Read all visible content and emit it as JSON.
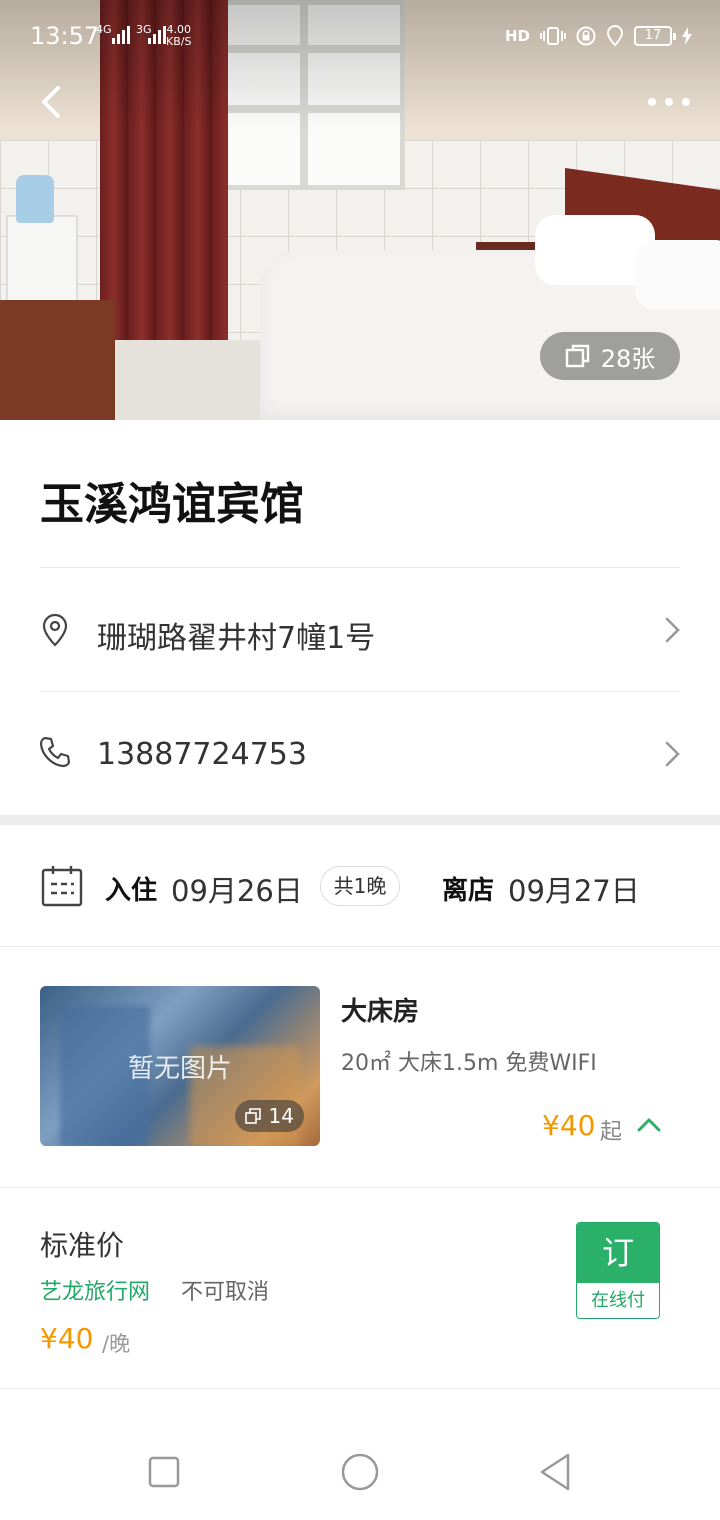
{
  "status_bar": {
    "time": "13:57",
    "net1": "4G",
    "net2": "3G",
    "speed_value": "4.00",
    "speed_unit": "KB/S",
    "hd": "HD",
    "battery": "17"
  },
  "hero": {
    "photo_count": "28张"
  },
  "hotel": {
    "name": "玉溪鸿谊宾馆",
    "address": "珊瑚路翟井村7幢1号",
    "phone": "13887724753"
  },
  "stay": {
    "checkin_label": "入住",
    "checkin_date": "09月26日",
    "nights": "共1晚",
    "checkout_label": "离店",
    "checkout_date": "09月27日"
  },
  "room": {
    "thumb_text": "暂无图片",
    "thumb_count": "14",
    "name": "大床房",
    "desc": "20㎡ 大床1.5m 免费WIFI",
    "price": "¥40",
    "price_suffix": "起"
  },
  "rate": {
    "name": "标准价",
    "source": "艺龙旅行网",
    "policy": "不可取消",
    "price": "¥40",
    "unit": "/晚",
    "book_label": "订",
    "pay_label": "在线付"
  },
  "colors": {
    "accent_green": "#2bb06a",
    "price_orange": "#f39800"
  }
}
